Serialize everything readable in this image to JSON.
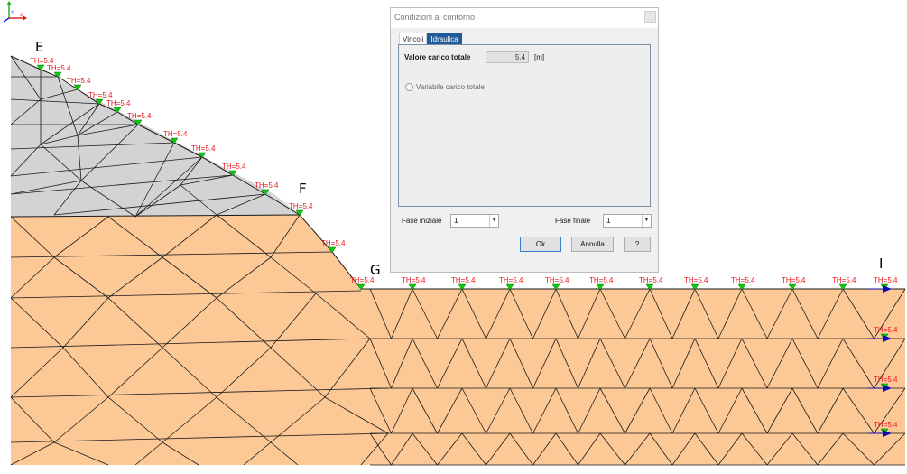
{
  "canvas": {
    "point_labels": [
      "E",
      "F",
      "G",
      "I"
    ],
    "condition_label": "TH=5.4",
    "colors": {
      "upper_material": "#d3d3d3",
      "lower_material": "#fcc895",
      "mesh_lines": "#1a1a1a",
      "condition_marker": "#10c810",
      "condition_text": "#e8191e",
      "flow_arrow": "#0a0ab4",
      "dialog_tab_active": "#1f5a99"
    },
    "icons": [
      "green-triangle-marker-icon",
      "blue-arrow-icon",
      "axes-icon"
    ]
  },
  "dialog": {
    "title": "Condizioni al contorno",
    "tabs": [
      "Vincoli",
      "Idraulica"
    ],
    "active_tab": "Idraulica",
    "total_head_label": "Valore carico totale",
    "total_head_value": "5.4",
    "total_head_unit": "[m]",
    "variable_option_label": "Variabile carico totale",
    "initial_phase_label": "Fase iniziale",
    "initial_phase_value": "1",
    "final_phase_label": "Fase finale",
    "final_phase_value": "1",
    "ok_label": "Ok",
    "cancel_label": "Annulla",
    "help_label": "?"
  }
}
